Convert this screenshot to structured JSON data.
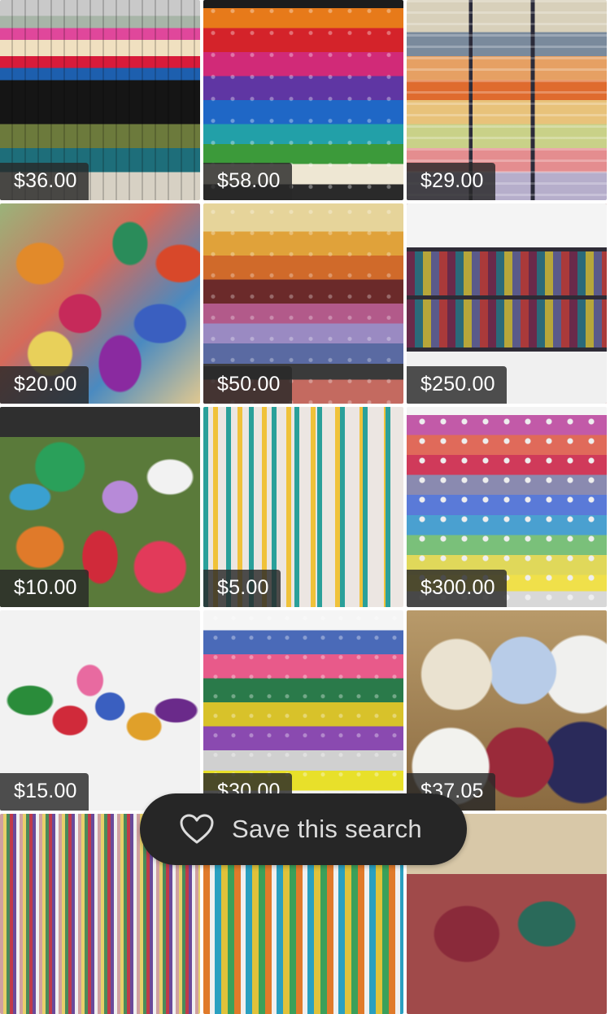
{
  "listings": [
    {
      "price": "$36.00",
      "image": "embroidery thread spools in plastic bags"
    },
    {
      "price": "$58.00",
      "image": "embroidery thread cones on rack"
    },
    {
      "price": "$29.00",
      "image": "floss bobbins in organizer box"
    },
    {
      "price": "$20.00",
      "image": "pile of embroidery floss skeins"
    },
    {
      "price": "$50.00",
      "image": "thread spools on rack"
    },
    {
      "price": "$250.00",
      "image": "drawer cabinet of Madeira threads"
    },
    {
      "price": "$10.00",
      "image": "pile of floss skeins on dark background"
    },
    {
      "price": "$5.00",
      "image": "floss skeins laid out in rows"
    },
    {
      "price": "$300.00",
      "image": "Floriani thread spools in display case"
    },
    {
      "price": "$15.00",
      "image": "floss skeins on white background"
    },
    {
      "price": "$30.00",
      "image": "embroidery thread spools on white"
    },
    {
      "price": "$37.05",
      "image": "large thread cones in cardboard box"
    },
    {
      "price": "",
      "image": "cross stitch floss card"
    },
    {
      "price": "",
      "image": "floss skeins in rows"
    },
    {
      "price": "",
      "image": "floss skeins in basket"
    }
  ],
  "save_search": {
    "label": "Save this search",
    "icon": "heart-outline-icon"
  }
}
